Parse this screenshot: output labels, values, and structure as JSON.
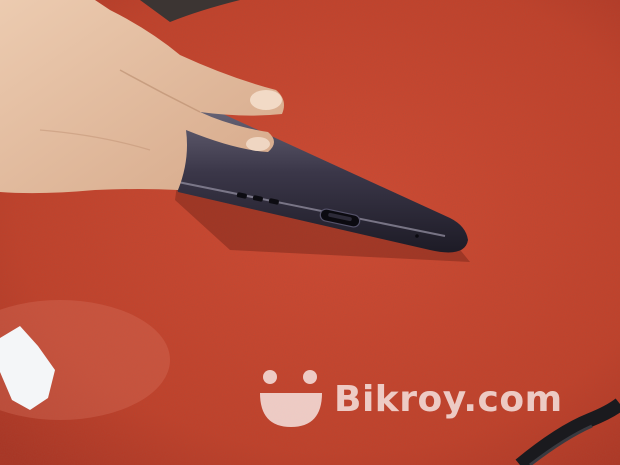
{
  "watermark": {
    "text": "Bikroy.com",
    "logo_icon": "bikroy-smile-logo-icon"
  },
  "scene": {
    "subjects": [
      "hand-icon",
      "smartphone-bottom-edge",
      "red-carpet-background"
    ],
    "colors": {
      "carpet": "#c9452f",
      "phone_frame": "#3a3648",
      "skin": "#e6c3a5",
      "watermark": "#ffffff"
    }
  }
}
